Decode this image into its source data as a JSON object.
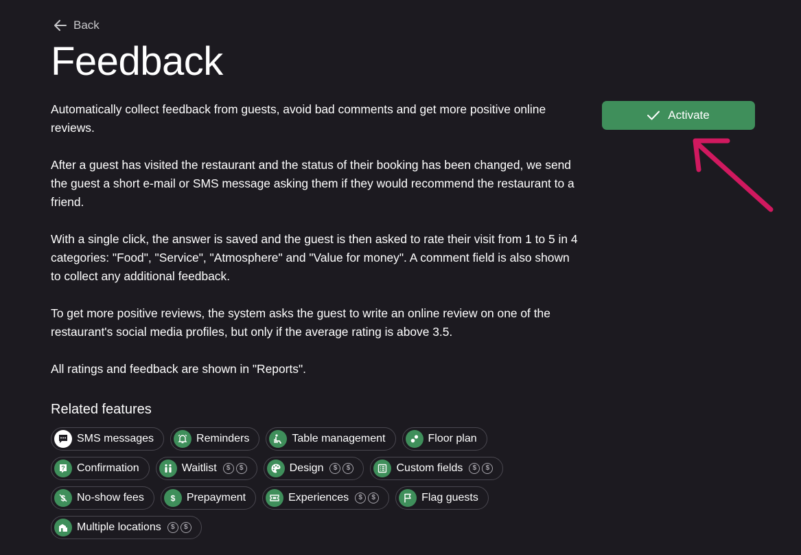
{
  "back_label": "Back",
  "title": "Feedback",
  "description": [
    "Automatically collect feedback from guests, avoid bad comments and get more positive online reviews.",
    "After a guest has visited the restaurant and the status of their booking has been changed, we send the guest a short e-mail or SMS message asking them if they would recommend the restaurant to a friend.",
    "With a single click, the answer is saved and the guest is then asked to rate their visit from 1 to 5 in 4 categories: \"Food\", \"Service\", \"Atmosphere\" and \"Value for money\". A comment field is also shown to collect any additional feedback.",
    "To get more positive reviews, the system asks the guest to write an online review on one of the restaurant's social media profiles, but only if the average rating is above 3.5.",
    "All ratings and feedback are shown in \"Reports\"."
  ],
  "activate_label": "Activate",
  "related_title": "Related features",
  "coin_symbol": "$",
  "colors": {
    "background": "#1c1a20",
    "accent": "#3f8f5b",
    "annotation_arrow": "#d0195f"
  },
  "features": [
    {
      "label": "SMS messages",
      "icon": "chat-bubble-icon",
      "paid": 0
    },
    {
      "label": "Reminders",
      "icon": "bell-icon",
      "paid": 0
    },
    {
      "label": "Table management",
      "icon": "chair-icon",
      "paid": 0
    },
    {
      "label": "Floor plan",
      "icon": "floor-plan-icon",
      "paid": 0
    },
    {
      "label": "Confirmation",
      "icon": "question-icon",
      "paid": 0
    },
    {
      "label": "Waitlist",
      "icon": "people-icon",
      "paid": 2
    },
    {
      "label": "Design",
      "icon": "palette-icon",
      "paid": 2
    },
    {
      "label": "Custom fields",
      "icon": "list-icon",
      "paid": 2
    },
    {
      "label": "No-show fees",
      "icon": "no-dollar-icon",
      "paid": 0
    },
    {
      "label": "Prepayment",
      "icon": "dollar-icon",
      "paid": 0
    },
    {
      "label": "Experiences",
      "icon": "ticket-icon",
      "paid": 2
    },
    {
      "label": "Flag guests",
      "icon": "flag-icon",
      "paid": 0
    },
    {
      "label": "Multiple locations",
      "icon": "buildings-icon",
      "paid": 2
    }
  ]
}
